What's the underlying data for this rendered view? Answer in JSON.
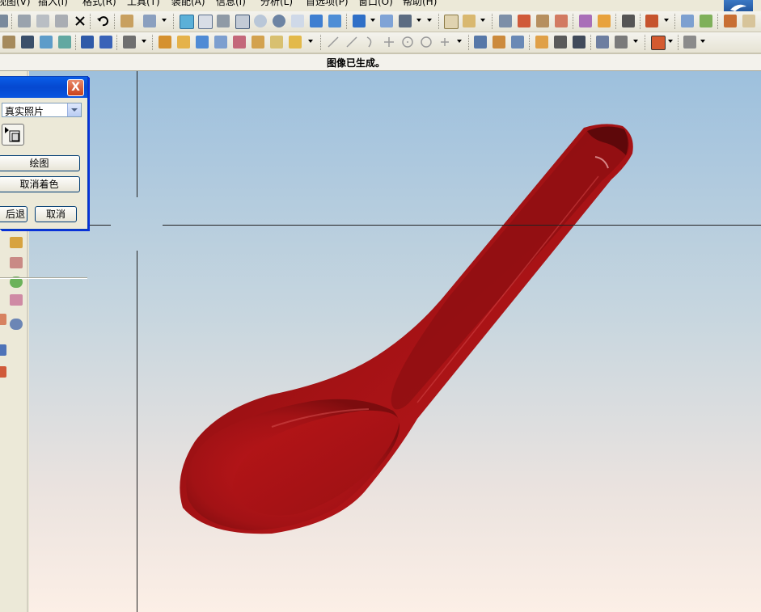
{
  "menu": [
    {
      "label": "视图(V)"
    },
    {
      "label": "插入(I)"
    },
    {
      "label": "格式(R)"
    },
    {
      "label": "工具(T)"
    },
    {
      "label": "装配(A)"
    },
    {
      "label": "信息(I)"
    },
    {
      "label": "分析(L)"
    },
    {
      "label": "首选项(P)"
    },
    {
      "label": "窗口(O)"
    },
    {
      "label": "帮助(H)"
    }
  ],
  "status": {
    "message": "图像已生成。"
  },
  "dialog": {
    "close_label": "X",
    "render_style": {
      "selected": "真实照片"
    },
    "draw_button": "绘图",
    "unshade_button": "取消着色",
    "back_button": "后退",
    "cancel_button": "取消"
  },
  "viewport": {
    "model": "spoon",
    "model_color": "#b21417",
    "background_top": "#9dc0dd",
    "background_bottom": "#fcefe6"
  }
}
